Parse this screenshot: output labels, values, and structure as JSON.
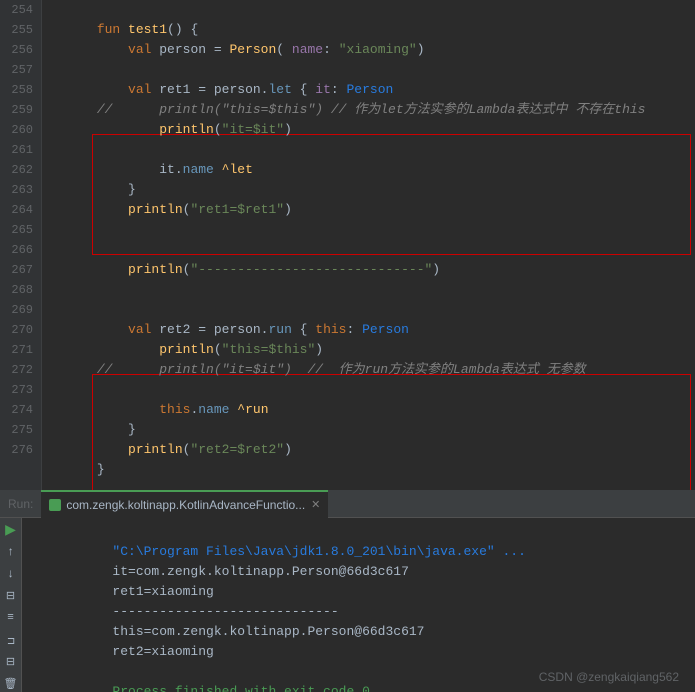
{
  "editor": {
    "lines": [
      {
        "num": "254",
        "tokens": [
          {
            "t": "kw",
            "v": "fun "
          },
          {
            "t": "fn-name",
            "v": "test1"
          },
          {
            "t": "white",
            "v": "() {"
          }
        ]
      },
      {
        "num": "255",
        "tokens": [
          {
            "t": "white",
            "v": "    "
          },
          {
            "t": "kw",
            "v": "val "
          },
          {
            "t": "white",
            "v": "person = "
          },
          {
            "t": "fn-name",
            "v": "Person"
          },
          {
            "t": "white",
            "v": "( "
          },
          {
            "t": "param-name",
            "v": "name"
          },
          {
            "t": "white",
            "v": ": "
          },
          {
            "t": "str",
            "v": "\"xiaoming\""
          },
          {
            "t": "white",
            "v": ")"
          }
        ]
      },
      {
        "num": "256",
        "tokens": []
      },
      {
        "num": "257",
        "tokens": [
          {
            "t": "white",
            "v": "    "
          },
          {
            "t": "kw",
            "v": "val "
          },
          {
            "t": "white",
            "v": "ret1 = person."
          },
          {
            "t": "method",
            "v": "let"
          },
          {
            "t": "white",
            "v": " { "
          },
          {
            "t": "param-name",
            "v": "it"
          },
          {
            "t": "white",
            "v": ": "
          },
          {
            "t": "type-name",
            "v": "Person"
          }
        ]
      },
      {
        "num": "258",
        "tokens": [
          {
            "t": "comment",
            "v": "//      println(\"this=$this\") // 作为let方法实参的Lambda表达式中 不存在this"
          }
        ]
      },
      {
        "num": "259",
        "tokens": [
          {
            "t": "white",
            "v": "        "
          },
          {
            "t": "fn-name",
            "v": "println"
          },
          {
            "t": "white",
            "v": "("
          },
          {
            "t": "str",
            "v": "\"it=$it\""
          },
          {
            "t": "white",
            "v": ")"
          }
        ]
      },
      {
        "num": "260",
        "tokens": []
      },
      {
        "num": "261",
        "tokens": [
          {
            "t": "white",
            "v": "        it."
          },
          {
            "t": "method",
            "v": "name"
          },
          {
            "t": "white",
            "v": " "
          },
          {
            "t": "label",
            "v": "^let"
          }
        ]
      },
      {
        "num": "262",
        "tokens": [
          {
            "t": "white",
            "v": "    }"
          }
        ]
      },
      {
        "num": "263",
        "tokens": [
          {
            "t": "white",
            "v": "    "
          },
          {
            "t": "fn-name",
            "v": "println"
          },
          {
            "t": "white",
            "v": "("
          },
          {
            "t": "str",
            "v": "\"ret1=$ret1\""
          },
          {
            "t": "white",
            "v": ")"
          }
        ]
      },
      {
        "num": "264",
        "tokens": []
      },
      {
        "num": "265",
        "tokens": []
      },
      {
        "num": "266",
        "tokens": [
          {
            "t": "white",
            "v": "    "
          },
          {
            "t": "fn-name",
            "v": "println"
          },
          {
            "t": "white",
            "v": "("
          },
          {
            "t": "str",
            "v": "\"-----------------------------\""
          },
          {
            "t": "white",
            "v": ")"
          }
        ]
      },
      {
        "num": "267",
        "tokens": []
      },
      {
        "num": "268",
        "tokens": []
      },
      {
        "num": "269",
        "tokens": [
          {
            "t": "white",
            "v": "    "
          },
          {
            "t": "kw",
            "v": "val "
          },
          {
            "t": "white",
            "v": "ret2 = person."
          },
          {
            "t": "method",
            "v": "run"
          },
          {
            "t": "white",
            "v": " { "
          },
          {
            "t": "kw",
            "v": "this"
          },
          {
            "t": "white",
            "v": ": "
          },
          {
            "t": "type-name",
            "v": "Person"
          }
        ]
      },
      {
        "num": "270",
        "tokens": [
          {
            "t": "white",
            "v": "        "
          },
          {
            "t": "fn-name",
            "v": "println"
          },
          {
            "t": "white",
            "v": "("
          },
          {
            "t": "str",
            "v": "\"this=$this\""
          },
          {
            "t": "white",
            "v": ")"
          }
        ]
      },
      {
        "num": "271",
        "tokens": [
          {
            "t": "comment",
            "v": "//      println(\"it=$it\")  //  作为run方法实参的Lambda表达式 无参数"
          }
        ]
      },
      {
        "num": "272",
        "tokens": []
      },
      {
        "num": "273",
        "tokens": [
          {
            "t": "white",
            "v": "        "
          },
          {
            "t": "kw",
            "v": "this"
          },
          {
            "t": "white",
            "v": "."
          },
          {
            "t": "method",
            "v": "name"
          },
          {
            "t": "white",
            "v": " "
          },
          {
            "t": "label",
            "v": "^run"
          }
        ]
      },
      {
        "num": "274",
        "tokens": [
          {
            "t": "white",
            "v": "    }"
          }
        ]
      },
      {
        "num": "275",
        "tokens": [
          {
            "t": "white",
            "v": "    "
          },
          {
            "t": "fn-name",
            "v": "println"
          },
          {
            "t": "white",
            "v": "("
          },
          {
            "t": "str",
            "v": "\"ret2=$ret2\""
          },
          {
            "t": "white",
            "v": ")"
          }
        ]
      },
      {
        "num": "276",
        "tokens": [
          {
            "t": "white",
            "v": "}"
          }
        ]
      }
    ]
  },
  "run_panel": {
    "tab_label": "com.zengk.koltinapp.KotlinAdvanceFunctio...",
    "run_label": "Run:",
    "output_lines": [
      "\"C:\\Program Files\\Java\\jdk1.8.0_201\\bin\\java.exe\" ...",
      "it=com.zengk.koltinapp.Person@66d3c617",
      "ret1=xiaoming",
      "-----------------------------",
      "this=com.zengk.koltinapp.Person@66d3c617",
      "ret2=xiaoming",
      "",
      "Process finished with exit code 0"
    ],
    "watermark": "CSDN @zengkaiqiang562"
  }
}
